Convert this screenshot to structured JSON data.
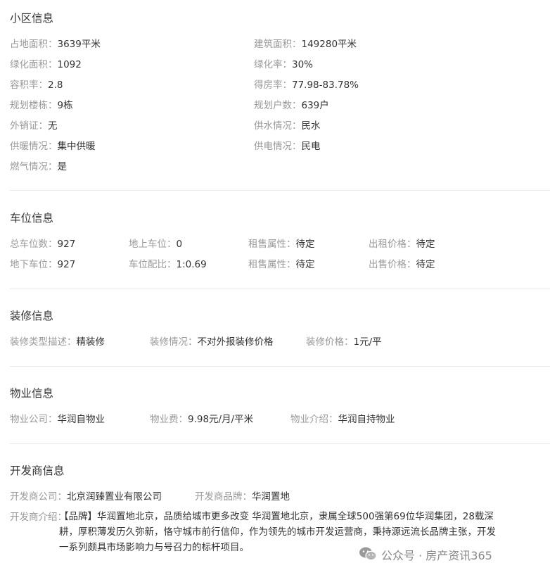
{
  "community": {
    "title": "小区信息",
    "rows": [
      {
        "l1": "占地面积：",
        "v1": "3639平米",
        "l2": "建筑面积：",
        "v2": "149280平米"
      },
      {
        "l1": "绿化面积：",
        "v1": "1092",
        "l2": "绿化率：",
        "v2": "30%"
      },
      {
        "l1": "容积率：",
        "v1": "2.8",
        "l2": "得房率：",
        "v2": "77.98-83.78%"
      },
      {
        "l1": "规划楼栋：",
        "v1": "9栋",
        "l2": "规划户数：",
        "v2": "639户"
      },
      {
        "l1": "外销证：",
        "v1": "无",
        "l2": "供水情况：",
        "v2": "民水"
      },
      {
        "l1": "供暖情况：",
        "v1": "集中供暖",
        "l2": "供电情况：",
        "v2": "民电"
      },
      {
        "l1": "燃气情况：",
        "v1": "是"
      }
    ]
  },
  "parking": {
    "title": "车位信息",
    "rows": [
      {
        "l1": "总车位数：",
        "v1": "927",
        "l2": "地上车位：",
        "v2": "0",
        "l3": "租售属性：",
        "v3": "待定",
        "l4": "出租价格：",
        "v4": "待定"
      },
      {
        "l1": "地下车位：",
        "v1": "927",
        "l2": "车位配比：",
        "v2": "1:0.69",
        "l3": "租售属性：",
        "v3": "待定",
        "l4": "出售价格：",
        "v4": "待定"
      }
    ]
  },
  "decoration": {
    "title": "装修信息",
    "type_label": "装修类型描述：",
    "type_value": "精装修",
    "status_label": "装修情况：",
    "status_value": "不对外报装修价格",
    "price_label": "装修价格：",
    "price_value": "1元/平"
  },
  "property": {
    "title": "物业信息",
    "company_label": "物业公司：",
    "company_value": "华润自物业",
    "fee_label": "物业费：",
    "fee_value": "9.98元/月/平米",
    "intro_label": "物业介绍：",
    "intro_value": "华润自持物业"
  },
  "developer": {
    "title": "开发商信息",
    "company_label": "开发商公司：",
    "company_value": "北京润臻置业有限公司",
    "brand_label": "开发商品牌：",
    "brand_value": "华润置地",
    "intro_label": "开发商介绍：",
    "intro_lines": [
      "【品牌】华润置地北京，品质给城市更多改变 华润置地北京，隶属全球500强第69位华润集团，28载深",
      "耕，厚积薄发历久弥新，恪守城市前行信仰，作为领先的城市开发运营商，秉持源远流长品牌主张，开发",
      "一系列颇具市场影响力与号召力的标杆项目。"
    ]
  },
  "watermark": {
    "text": "公众号 · 房产资讯365",
    "icon": "wechat-icon"
  }
}
